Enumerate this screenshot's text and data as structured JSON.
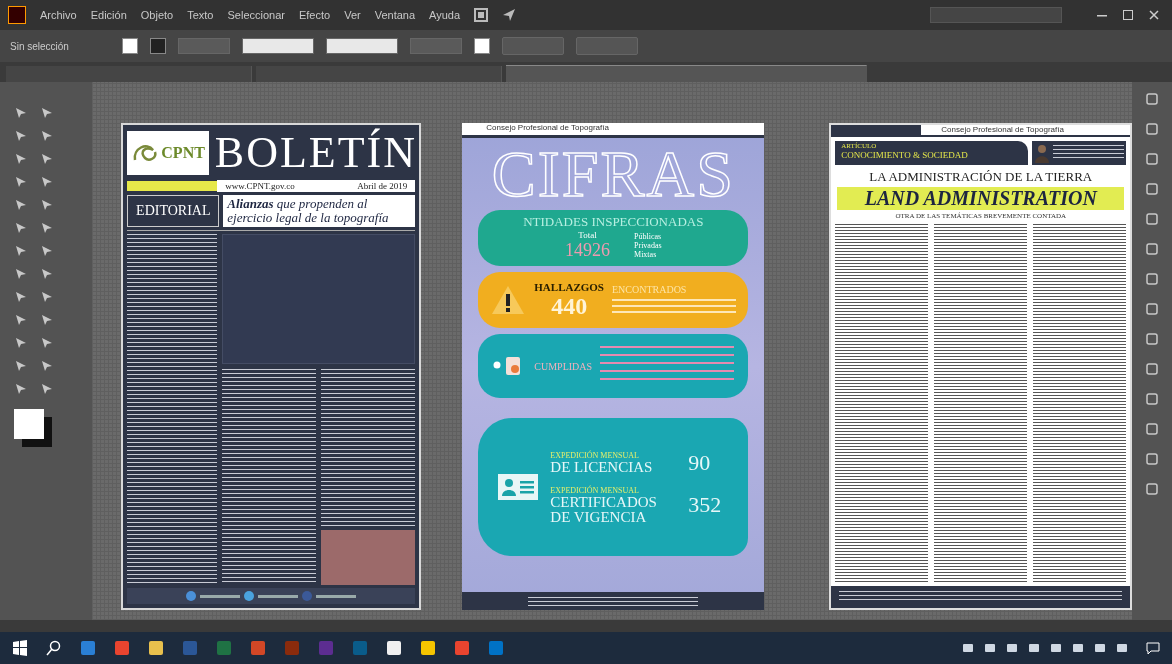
{
  "menu_bar": {
    "items": [
      "Archivo",
      "Edición",
      "Objeto",
      "Texto",
      "Seleccionar",
      "Efecto",
      "Ver",
      "Ventana",
      "Ayuda"
    ]
  },
  "control_bar": {
    "selection_label": "Sin selección"
  },
  "tabs": [
    {
      "selected": false
    },
    {
      "selected": false
    },
    {
      "selected": true
    }
  ],
  "pages": [
    {
      "kind": "boletin",
      "logo": "CPNT",
      "title": "BOLETÍN",
      "website": "www.CPNT.gov.co",
      "date": "Abril de 2019",
      "section": "EDITORIAL",
      "headline": "**Alianzas** que propenden al ejercicio legal de la topografía"
    },
    {
      "kind": "cifras",
      "header": "Consejo Profesional de Topografía",
      "title": "CIFRAS",
      "entities": {
        "heading": "NTIDADES INSPECCIONADAS",
        "total_label": "Total",
        "total": "14926",
        "breakdown": [
          "Públicas",
          "Privadas",
          "Mixtas"
        ]
      },
      "findings": {
        "heading": "HALLAZGOS",
        "subheading": "ENCONTRADOS",
        "value": "440"
      },
      "complaints": {
        "heading": "CUMPLIDAS"
      },
      "issuance": [
        {
          "caption": "EXPEDICIÓN MENSUAL",
          "label": "DE LICENCIAS",
          "value": "90"
        },
        {
          "caption": "EXPEDICIÓN MENSUAL",
          "label": "CERTIFICADOS DE VIGENCIA",
          "value": "352"
        }
      ]
    },
    {
      "kind": "articulo",
      "header": "Consejo Profesional de Topografía",
      "section": "ARTÍCULO",
      "category": "CONOCIMIENTO & SOCIEDAD",
      "title": "LA ADMINISTRACIÓN DE LA TIERRA",
      "title_en": "LAND ADMINISTRATION",
      "subtitle": "OTRA DE LAS TEMÁTICAS BREVEMENTE CONTADA"
    }
  ]
}
